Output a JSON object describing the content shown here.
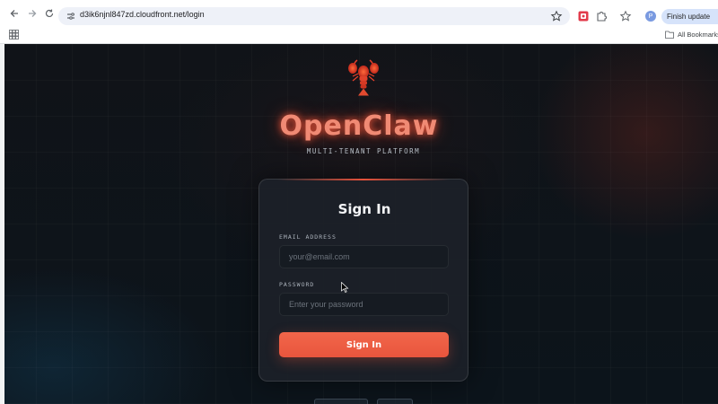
{
  "browser": {
    "url": "d3ik6njnl847zd.cloudfront.net/login",
    "finish_update_label": "Finish update",
    "all_bookmarks_label": "All Bookmarks",
    "profile_initial": "P"
  },
  "page": {
    "brand": "OpenClaw",
    "subtitle": "MULTI-TENANT PLATFORM",
    "form": {
      "title": "Sign In",
      "email_label": "EMAIL ADDRESS",
      "email_placeholder": "your@email.com",
      "email_value": "",
      "password_label": "PASSWORD",
      "password_placeholder": "Enter your password",
      "password_value": "",
      "submit_label": "Sign In"
    }
  },
  "colors": {
    "accent": "#e8553d",
    "card_bg": "#1c2128",
    "page_bg": "#0e1419"
  },
  "icons": [
    "back-arrow-icon",
    "forward-arrow-icon",
    "reload-icon",
    "site-info-icon",
    "bookmark-star-icon",
    "extension-icon",
    "puzzle-icon",
    "star-icon",
    "apps-grid-icon",
    "folder-icon",
    "lobster-logo",
    "mouse-cursor-icon"
  ]
}
